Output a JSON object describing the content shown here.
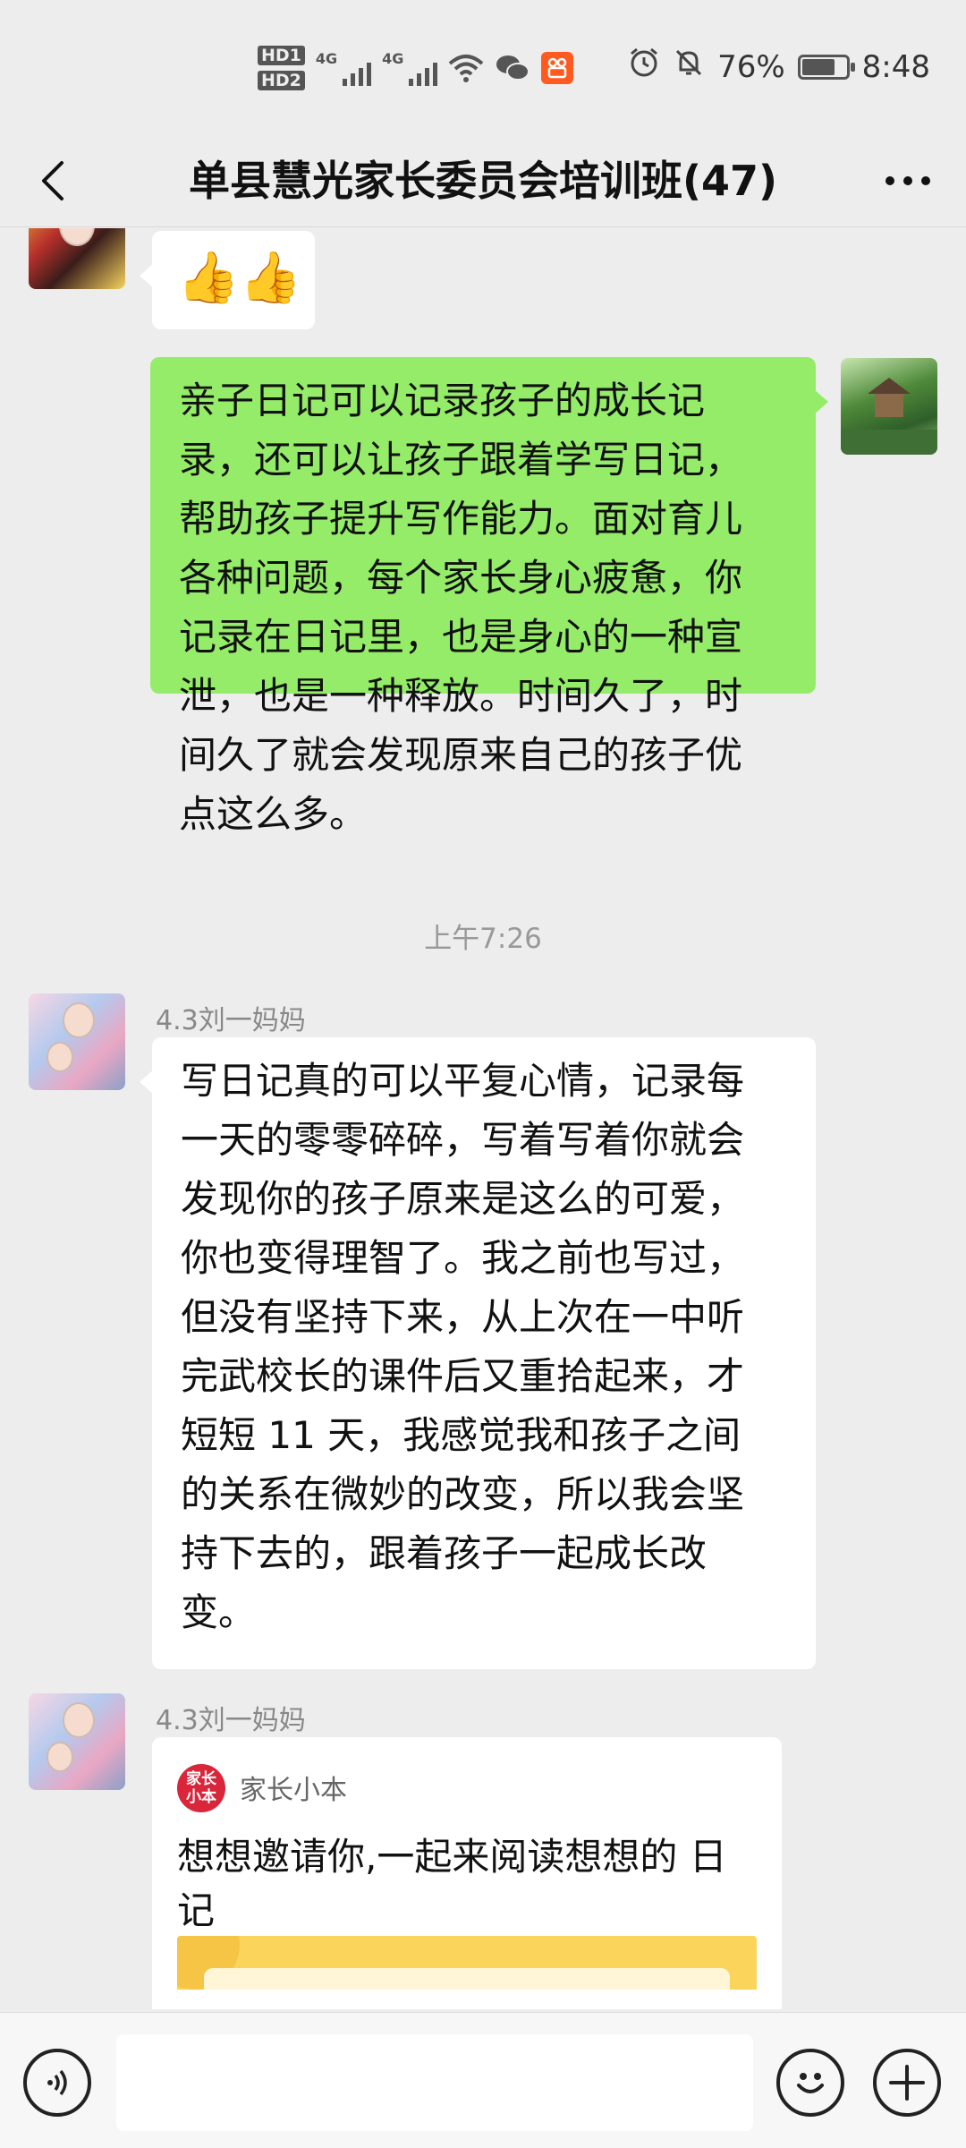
{
  "status_bar": {
    "sim1": "HD1",
    "sim2": "HD2",
    "net1": "4G",
    "net2": "4G",
    "battery_percent_text": "76%",
    "battery_level": 0.76,
    "time": "8:48",
    "icons": [
      "wifi-icon",
      "wechat-icon",
      "kuaishou-icon",
      "alarm-icon",
      "mute-bell-icon",
      "battery-icon"
    ]
  },
  "header": {
    "title": "单县慧光家长委员会培训班(47)",
    "back_icon": "chevron-left-icon",
    "more_icon": "more-horizontal-icon"
  },
  "messages": {
    "m1": {
      "emoji": "👍👍"
    },
    "m2": {
      "lines": [
        "亲子日记可以记录孩子的成长记",
        "录，还可以让孩子跟着学写日记，",
        "帮助孩子提升写作能力。面对育儿",
        "各种问题，每个家长身心疲惫，你",
        "记录在日记里，也是身心的一种宣",
        "泄，也是一种释放。时间久了，时",
        "间久了就会发现原来自己的孩子优",
        "点这么多。"
      ]
    },
    "time_divider": "上午7:26",
    "m3": {
      "sender": "4.3刘一妈妈",
      "lines": [
        "写日记真的可以平复心情，记录每",
        "一天的零零碎碎，写着写着你就会",
        "发现你的孩子原来是这么的可爱，",
        "你也变得理智了。我之前也写过，",
        "但没有坚持下来，从上次在一中听",
        "完武校长的课件后又重拾起来，才",
        "短短 11 天，我感觉我和孩子之间",
        "的关系在微妙的改变，所以我会坚",
        "持下去的，跟着孩子一起成长改",
        "变。"
      ]
    },
    "m4": {
      "sender": "4.3刘一妈妈",
      "card_logo": "家长\n小本",
      "card_source": "家长小本",
      "card_title_lines": [
        "想想邀请你,一起来阅读想想的",
        "日记"
      ]
    }
  },
  "input_bar": {
    "placeholder": "",
    "icons": [
      "voice-icon",
      "emoji-icon",
      "plus-icon"
    ]
  }
}
